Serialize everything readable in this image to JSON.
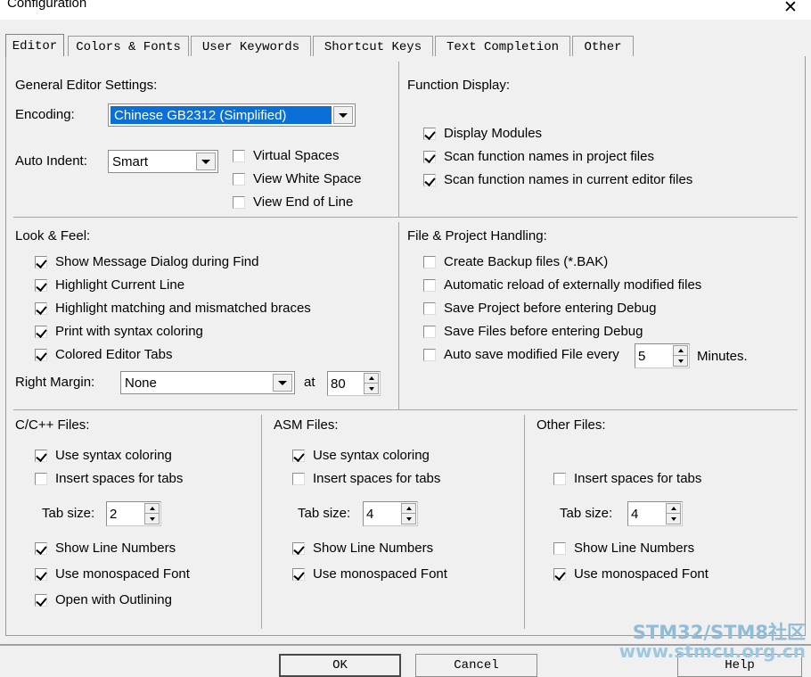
{
  "window": {
    "title": "Configuration",
    "close_icon": "close-icon"
  },
  "tabs": [
    {
      "label": "Editor",
      "active": true
    },
    {
      "label": "Colors & Fonts",
      "active": false
    },
    {
      "label": "User Keywords",
      "active": false
    },
    {
      "label": "Shortcut Keys",
      "active": false
    },
    {
      "label": "Text Completion",
      "active": false
    },
    {
      "label": "Other",
      "active": false
    }
  ],
  "general_editor": {
    "title": "General Editor Settings:",
    "encoding_label": "Encoding:",
    "encoding_value": "Chinese GB2312 (Simplified)",
    "auto_indent_label": "Auto Indent:",
    "auto_indent_value": "Smart",
    "checkboxes": [
      {
        "label": "Virtual Spaces",
        "checked": false
      },
      {
        "label": "View White Space",
        "checked": false
      },
      {
        "label": "View End of Line",
        "checked": false
      }
    ]
  },
  "function_display": {
    "title": "Function Display:",
    "checkboxes": [
      {
        "label": "Display Modules",
        "checked": true
      },
      {
        "label": "Scan function names in project files",
        "checked": true
      },
      {
        "label": "Scan function names in current editor files",
        "checked": true
      }
    ]
  },
  "look_and_feel": {
    "title": "Look & Feel:",
    "checkboxes": [
      {
        "label": "Show Message Dialog during Find",
        "checked": true
      },
      {
        "label": "Highlight Current Line",
        "checked": true
      },
      {
        "label": "Highlight matching and mismatched braces",
        "checked": true
      },
      {
        "label": "Print with syntax coloring",
        "checked": true
      },
      {
        "label": "Colored Editor Tabs",
        "checked": true
      }
    ],
    "right_margin_label": "Right Margin:",
    "right_margin_value": "None",
    "at_label": "at",
    "at_value": "80"
  },
  "file_project": {
    "title": "File & Project Handling:",
    "checkboxes": [
      {
        "label": "Create Backup files (*.BAK)",
        "checked": false
      },
      {
        "label": "Automatic reload of externally modified files",
        "checked": false
      },
      {
        "label": "Save Project before entering Debug",
        "checked": false
      },
      {
        "label": "Save Files before entering Debug",
        "checked": false
      }
    ],
    "autosave_label": "Auto save modified File every",
    "autosave_checked": false,
    "autosave_value": "5",
    "autosave_unit": "Minutes."
  },
  "c_files": {
    "title": "C/C++ Files:",
    "syntax_coloring": {
      "label": "Use syntax coloring",
      "checked": true
    },
    "insert_spaces": {
      "label": "Insert spaces for tabs",
      "checked": false
    },
    "tab_size_label": "Tab size:",
    "tab_size_value": "2",
    "line_numbers": {
      "label": "Show Line Numbers",
      "checked": true
    },
    "monospaced": {
      "label": "Use monospaced Font",
      "checked": true
    },
    "outlining": {
      "label": "Open with Outlining",
      "checked": true
    }
  },
  "asm_files": {
    "title": "ASM Files:",
    "syntax_coloring": {
      "label": "Use syntax coloring",
      "checked": true
    },
    "insert_spaces": {
      "label": "Insert spaces for tabs",
      "checked": false
    },
    "tab_size_label": "Tab size:",
    "tab_size_value": "4",
    "line_numbers": {
      "label": "Show Line Numbers",
      "checked": true
    },
    "monospaced": {
      "label": "Use monospaced Font",
      "checked": true
    }
  },
  "other_files": {
    "title": "Other Files:",
    "insert_spaces": {
      "label": "Insert spaces for tabs",
      "checked": false
    },
    "tab_size_label": "Tab size:",
    "tab_size_value": "4",
    "line_numbers": {
      "label": "Show Line Numbers",
      "checked": false
    },
    "monospaced": {
      "label": "Use monospaced Font",
      "checked": true
    }
  },
  "buttons": {
    "ok": "OK",
    "cancel": "Cancel",
    "help": "Help"
  },
  "watermark": {
    "line1": "STM32/STM8社区",
    "line2": "www.stmcu.org.cn",
    "color": "#8fbcd8"
  },
  "colors": {
    "dialog_bg": "#f0f0f0",
    "selection_blue": "#0a6fd6",
    "border": "#9a9a9a"
  }
}
